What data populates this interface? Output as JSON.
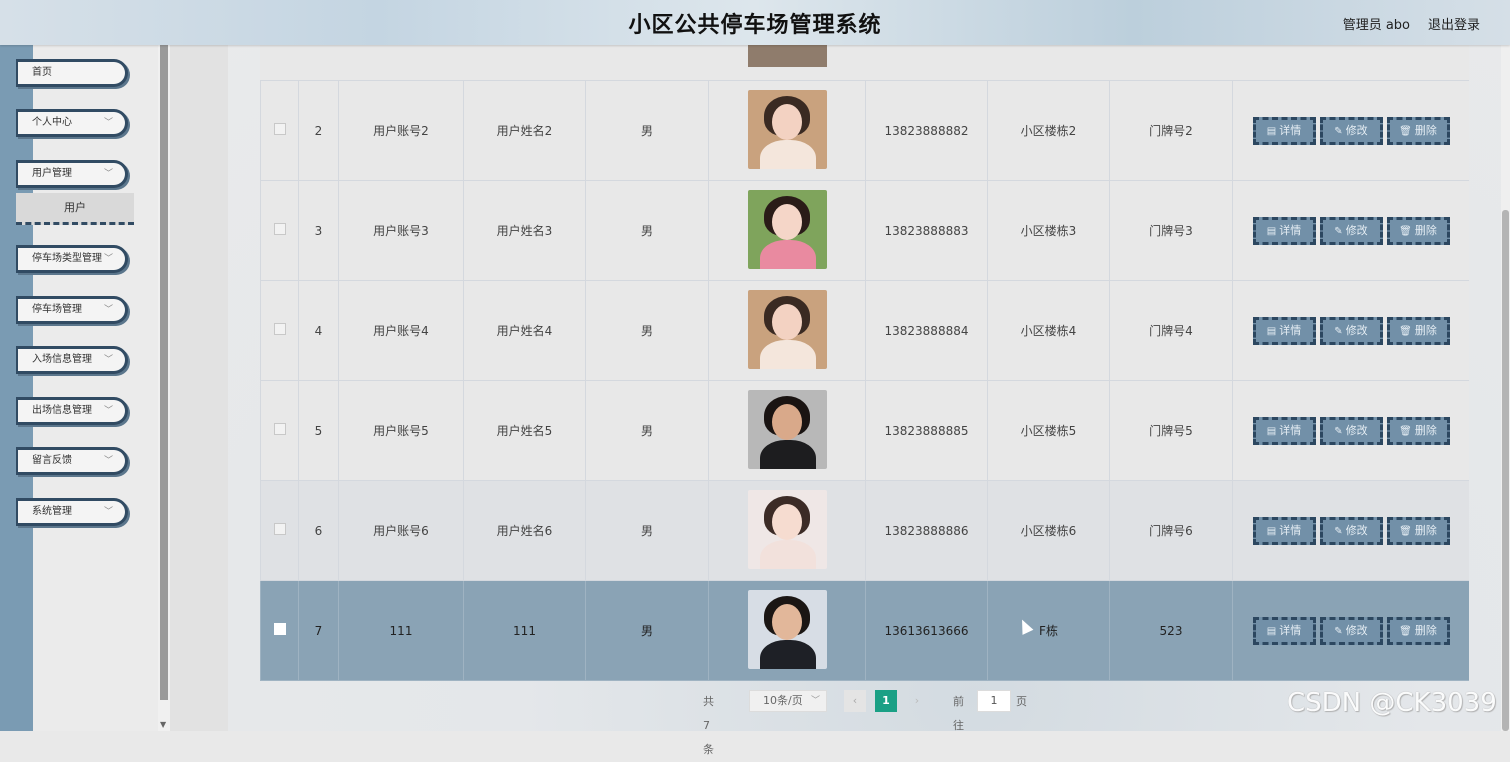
{
  "header": {
    "title": "小区公共停车场管理系统",
    "admin": "管理员 abo",
    "logout": "退出登录"
  },
  "sidebar": {
    "items": [
      {
        "label": "首页",
        "has_chevron": false
      },
      {
        "label": "个人中心",
        "has_chevron": true
      },
      {
        "label": "用户管理",
        "has_chevron": true
      },
      {
        "label": "停车场类型管理",
        "has_chevron": true
      },
      {
        "label": "停车场管理",
        "has_chevron": true
      },
      {
        "label": "入场信息管理",
        "has_chevron": true
      },
      {
        "label": "出场信息管理",
        "has_chevron": true
      },
      {
        "label": "留言反馈",
        "has_chevron": true
      },
      {
        "label": "系统管理",
        "has_chevron": true
      }
    ],
    "sub_item": "用户"
  },
  "table": {
    "rows": [
      {
        "no": "2",
        "account": "用户账号2",
        "name": "用户姓名2",
        "gender": "男",
        "phone": "13823888882",
        "building": "小区楼栋2",
        "door": "门牌号2",
        "avatar": {
          "skin": "#f3d2c2",
          "hair": "#3a2a22",
          "bg": "#c9a27e",
          "body": "#f4e6dc"
        }
      },
      {
        "no": "3",
        "account": "用户账号3",
        "name": "用户姓名3",
        "gender": "男",
        "phone": "13823888883",
        "building": "小区楼栋3",
        "door": "门牌号3",
        "avatar": {
          "skin": "#f5d6c8",
          "hair": "#2a1c18",
          "bg": "#7fa45c",
          "body": "#e98aa0"
        }
      },
      {
        "no": "4",
        "account": "用户账号4",
        "name": "用户姓名4",
        "gender": "男",
        "phone": "13823888884",
        "building": "小区楼栋4",
        "door": "门牌号4",
        "avatar": {
          "skin": "#f3d2c2",
          "hair": "#3a2a22",
          "bg": "#c9a27e",
          "body": "#f4e6dc"
        }
      },
      {
        "no": "5",
        "account": "用户账号5",
        "name": "用户姓名5",
        "gender": "男",
        "phone": "13823888885",
        "building": "小区楼栋5",
        "door": "门牌号5",
        "avatar": {
          "skin": "#d9a98a",
          "hair": "#1a1412",
          "bg": "#b8b8b8",
          "body": "#1d1d1f"
        }
      },
      {
        "no": "6",
        "account": "用户账号6",
        "name": "用户姓名6",
        "gender": "男",
        "phone": "13823888886",
        "building": "小区楼栋6",
        "door": "门牌号6",
        "avatar": {
          "skin": "#f6dcd0",
          "hair": "#3c2b26",
          "bg": "#efe7e6",
          "body": "#f2e1dc"
        }
      },
      {
        "no": "7",
        "account": "111",
        "name": "111",
        "gender": "男",
        "phone": "13613613666",
        "building": "F栋",
        "door": "523",
        "avatar": {
          "skin": "#e2b79a",
          "hair": "#1b1614",
          "bg": "#d7dde5",
          "body": "#1e2026"
        }
      }
    ],
    "actions": {
      "detail": "详情",
      "edit": "修改",
      "delete": "删除"
    }
  },
  "pagination": {
    "total": "共 7 条",
    "page_size": "10条/页",
    "current_page": "1",
    "goto_label": "前往",
    "goto_value": "1",
    "page_unit": "页"
  },
  "watermark": "CSDN @CK3039",
  "colors": {
    "sidebar_accent": "#314b63",
    "selected_row": "#8aa3b5",
    "action_button": "#7290a8",
    "current_page": "#1aa085"
  }
}
